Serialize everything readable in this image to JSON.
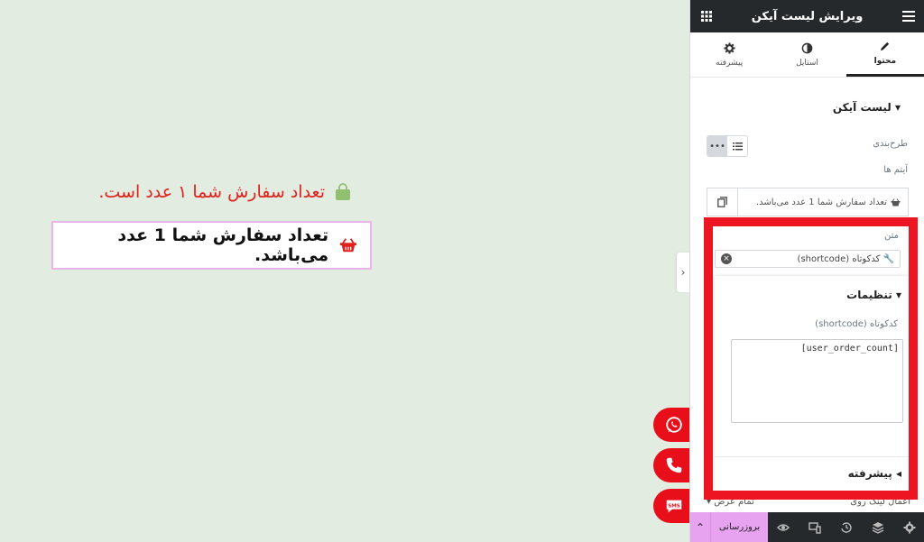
{
  "canvas": {
    "line1_text": "تعداد سفارش شما ۱ عدد است.",
    "line2_text": "تعداد سفارش شما 1 عدد می‌باشد."
  },
  "floating": {
    "whatsapp_icon": "whatsapp-icon",
    "phone_icon": "phone-icon",
    "sms_label": "SMS"
  },
  "panel": {
    "header_title": "ویرایش لیست آیکن",
    "tabs": [
      {
        "label": "محتوا",
        "icon": "pencil-icon"
      },
      {
        "label": "استایل",
        "icon": "half-circle-icon"
      },
      {
        "label": "پیشرفته",
        "icon": "gear-icon"
      }
    ],
    "section_title": "لیست آیکن",
    "layout_label": "طرح‌بندی",
    "items_label": "آیتم ها",
    "item_text": "تعداد سفارش شما 1 عدد می‌باشد.",
    "text_label": "متن",
    "shortcode_bar": "کدکوتاه (shortcode)",
    "popover": {
      "title": "تنظیمات",
      "field_label": "کدکوتاه (shortcode)",
      "field_value": "[user_order_count]",
      "advanced": "پیشرفته"
    },
    "under_row": {
      "left": "تمام عرض",
      "right": "اعمال لینک روی"
    },
    "footer": {
      "update_label": "بروزرسانی"
    }
  },
  "colors": {
    "accent_red": "#ee1522",
    "panel_dark": "#26292c",
    "update_pink": "#e8a3f0",
    "canvas_bg": "#e3ece0",
    "bag_green": "#8fbf6f"
  }
}
